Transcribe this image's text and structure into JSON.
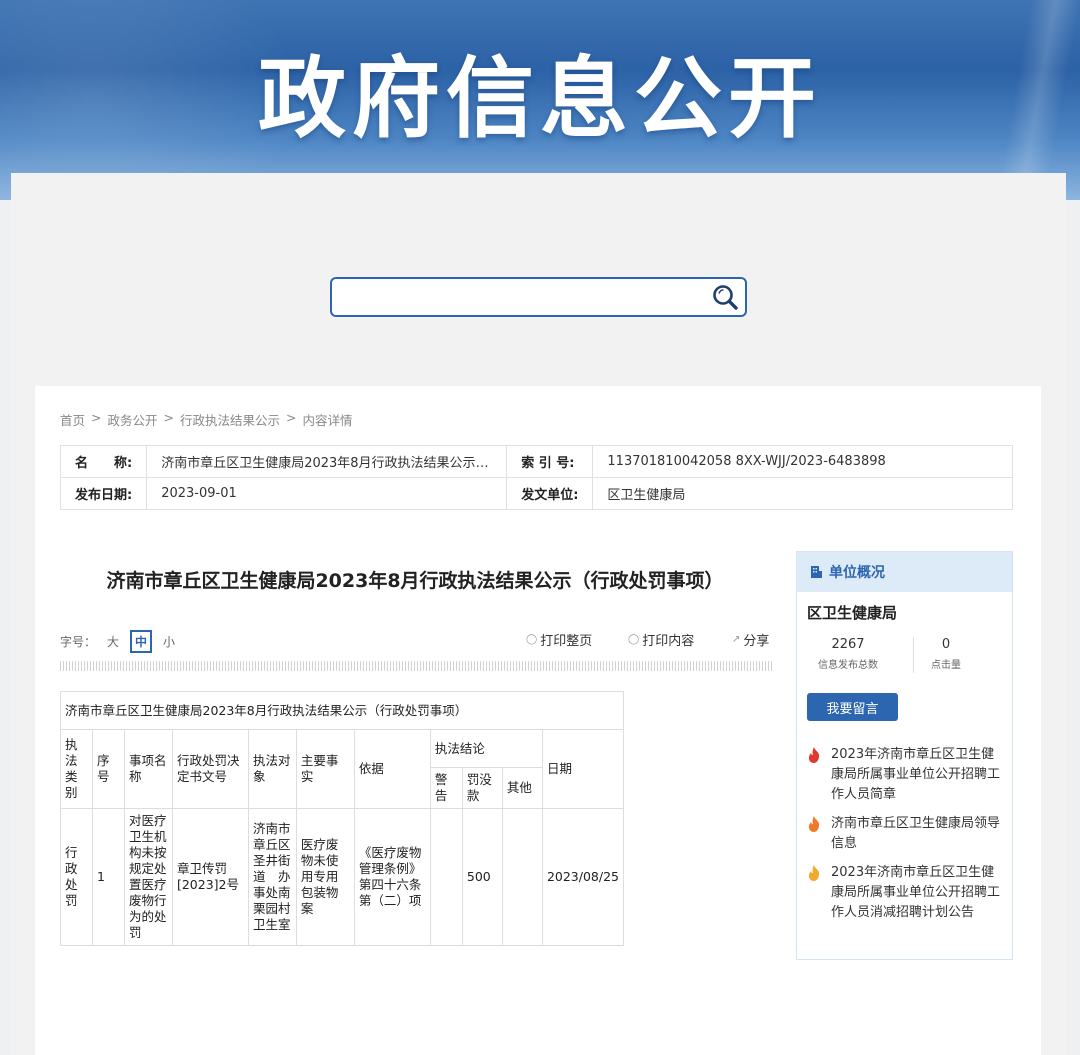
{
  "banner": {
    "title": "政府信息公开"
  },
  "search": {
    "value": "",
    "placeholder": ""
  },
  "breadcrumb": {
    "home": "首页",
    "sep": ">",
    "l1": "政务公开",
    "l2": "行政执法结果公示",
    "l3": "内容详情"
  },
  "meta": {
    "name_label": "名　　称:",
    "name_value": "济南市章丘区卫生健康局2023年8月行政执法结果公示（行...",
    "index_label": "索 引 号:",
    "index_value": "113701810042058 8XX-WJJ/2023-6483898",
    "date_label": "发布日期:",
    "date_value": "2023-09-01",
    "unit_label": "发文单位:",
    "unit_value": "区卫生健康局"
  },
  "article": {
    "title": "济南市章丘区卫生健康局2023年8月行政执法结果公示（行政处罚事项）",
    "font_size_label": "字号：",
    "font_sizes": [
      "大",
      "中",
      "小"
    ],
    "print_page": "打印整页",
    "print_content": "打印内容",
    "share": "分享"
  },
  "table": {
    "caption": "济南市章丘区卫生健康局2023年8月行政执法结果公示（行政处罚事项）",
    "headers": {
      "category": "执法类别",
      "no": "序号",
      "item": "事项名称",
      "doc_no": "行政处罚决定书文号",
      "target": "执法对象",
      "facts": "主要事实",
      "basis": "依据",
      "conclusion": "执法结论",
      "warning": "警告",
      "fine": "罚没款",
      "other": "其他",
      "date": "日期"
    },
    "rows": [
      {
        "category": "行政处罚",
        "no": "1",
        "item": "对医疗卫生机构未按规定处置医疗废物行为的处罚",
        "doc_no": "章卫传罚[2023]2号",
        "target": "济南市章丘区圣井街道　办事处南栗园村卫生室",
        "facts": "医疗废物未使用专用包装物案",
        "basis": "《医疗废物管理条例》第四十六条第（二）项",
        "warning": "",
        "fine": "500",
        "other": "",
        "date": "2023/08/25"
      }
    ]
  },
  "sidebar": {
    "header": "单位概况",
    "unit_name": "区卫生健康局",
    "stats": [
      {
        "value": "2267",
        "label": "信息发布总数"
      },
      {
        "value": "0",
        "label": "点击量"
      }
    ],
    "message_button": "我要留言",
    "news": [
      {
        "text": "2023年济南市章丘区卫生健康局所属事业单位公开招聘工作人员简章",
        "color": "#e03a2f"
      },
      {
        "text": "济南市章丘区卫生健康局领导信息",
        "color": "#f07a2a"
      },
      {
        "text": "2023年济南市章丘区卫生健康局所属事业单位公开招聘工作人员消减招聘计划公告",
        "color": "#f0a92a"
      }
    ]
  },
  "colors": {
    "accent": "#2d66b0",
    "banner": "#2c62a6"
  }
}
